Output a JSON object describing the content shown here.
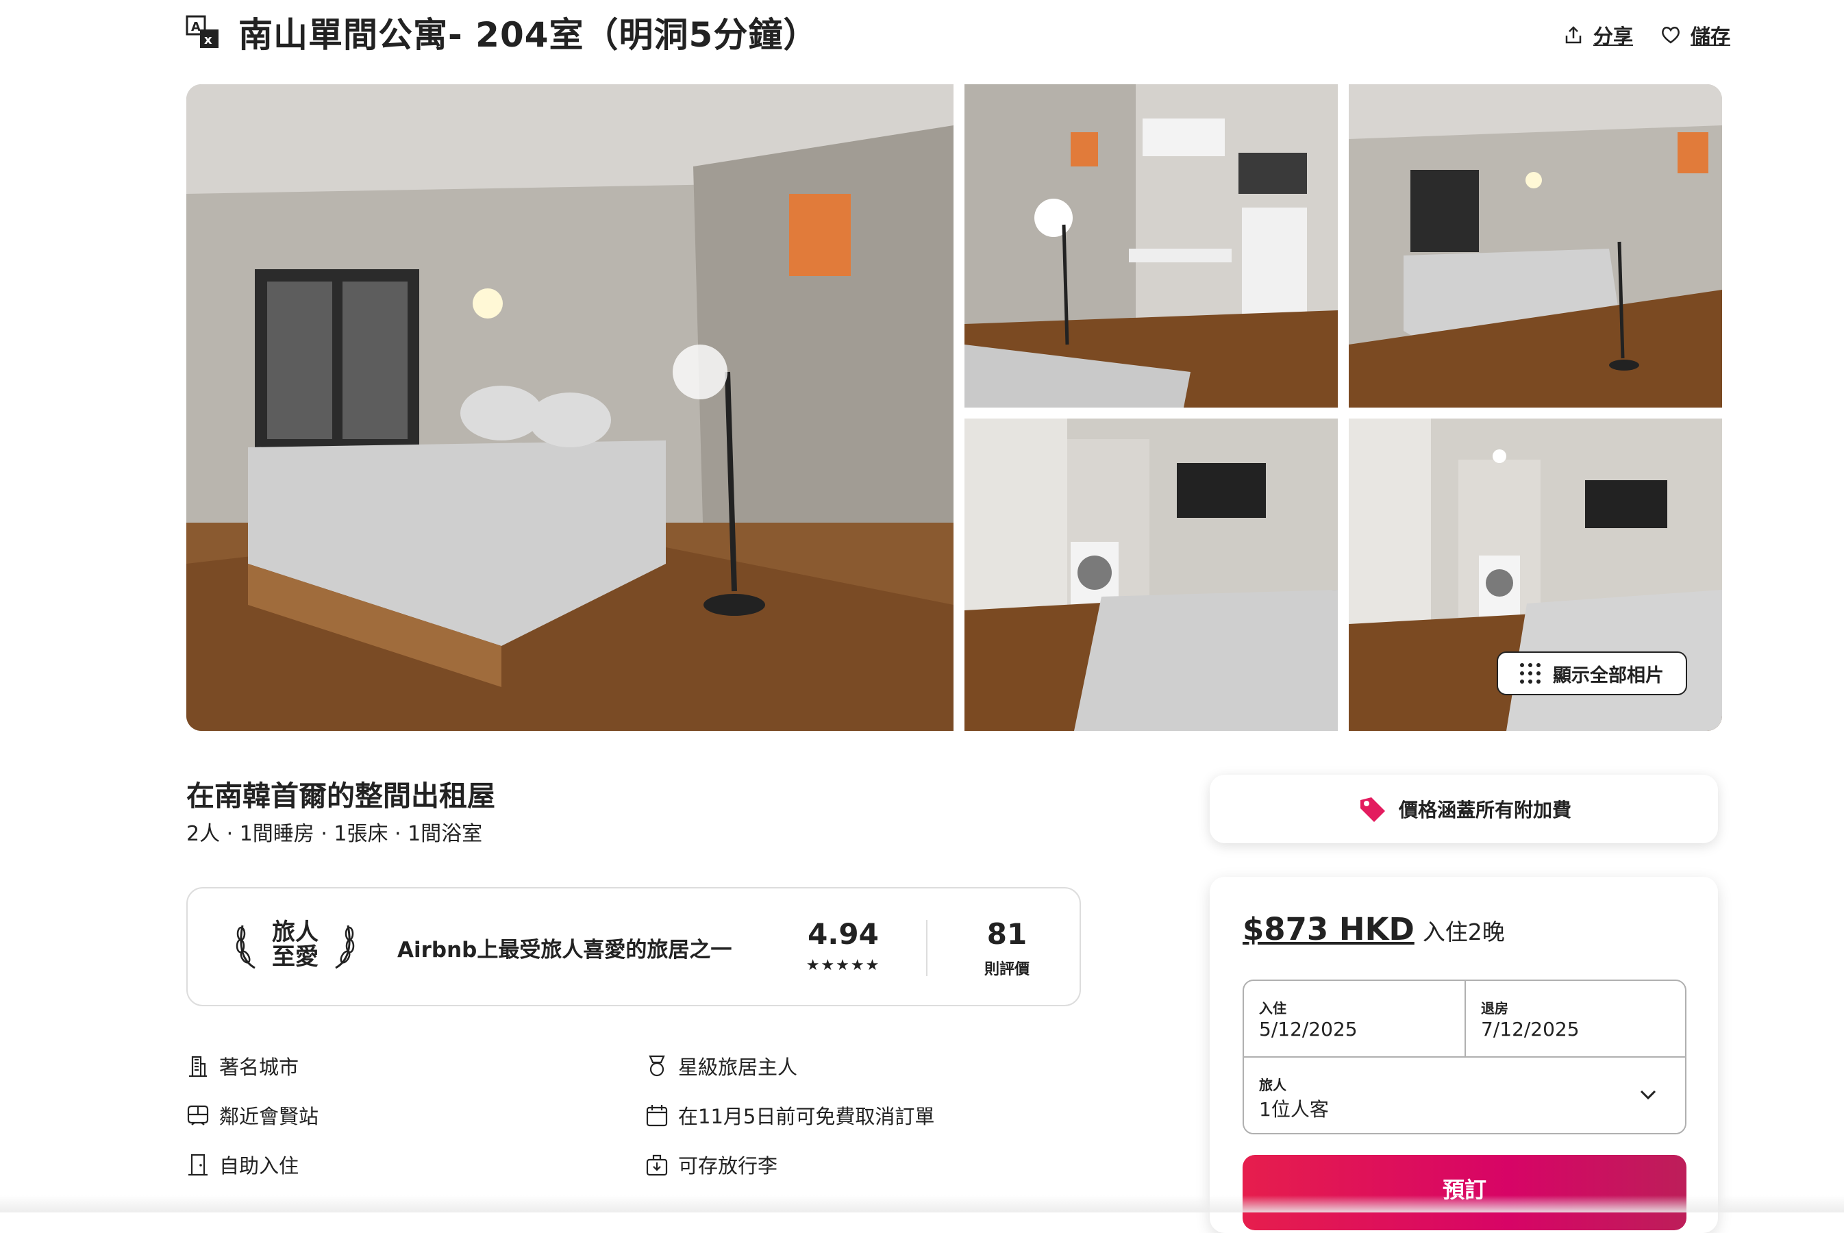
{
  "header": {
    "title": "南山單間公寓- 204室（明洞5分鐘）",
    "share_label": "分享",
    "save_label": "儲存"
  },
  "gallery": {
    "show_all_label": "顯示全部相片",
    "photos": [
      "bedroom-main",
      "kitchenette-desk",
      "bedroom-window",
      "kitchen-washer-tv",
      "studio-overview"
    ]
  },
  "listing": {
    "heading": "在南韓首爾的整間出租屋",
    "details": "2人 · 1間睡房 · 1張床 · 1間浴室"
  },
  "guest_favorite": {
    "badge_line1": "旅人",
    "badge_line2": "至愛",
    "description": "Airbnb上最受旅人喜愛的旅居之一",
    "rating": "4.94",
    "stars": "★★★★★",
    "review_count": "81",
    "review_label": "則評價"
  },
  "features": {
    "left": [
      {
        "icon": "building-icon",
        "label": "著名城市"
      },
      {
        "icon": "train-icon",
        "label": "鄰近會賢站"
      },
      {
        "icon": "door-icon",
        "label": "自助入住"
      }
    ],
    "right": [
      {
        "icon": "medal-icon",
        "label": "星級旅居主人"
      },
      {
        "icon": "calendar-icon",
        "label": "在11月5日前可免費取消訂單"
      },
      {
        "icon": "luggage-icon",
        "label": "可存放行李"
      }
    ]
  },
  "price_note": {
    "label": "價格涵蓋所有附加費"
  },
  "booking": {
    "price": "$873 HKD",
    "nights": "入住2晚",
    "checkin_label": "入住",
    "checkin_value": "5/12/2025",
    "checkout_label": "退房",
    "checkout_value": "7/12/2025",
    "guests_label": "旅人",
    "guests_value": "1位人客",
    "reserve_label": "預訂"
  },
  "colors": {
    "accent": "#e61e4d",
    "text": "#222222",
    "border": "#dddddd"
  }
}
